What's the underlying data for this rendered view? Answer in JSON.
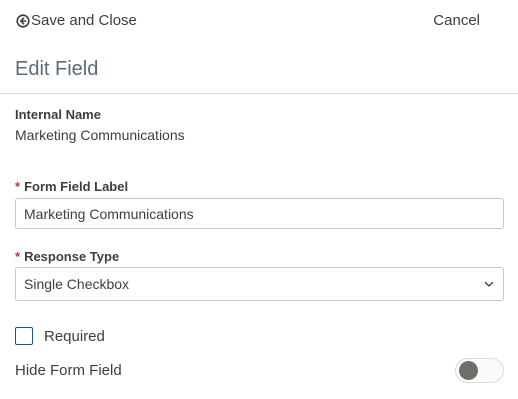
{
  "header": {
    "save_close_label": "Save and Close",
    "save_close_icon": "arrow-circle-back-icon",
    "cancel_label": "Cancel"
  },
  "panel": {
    "title": "Edit Field"
  },
  "fields": {
    "internal_name": {
      "label": "Internal Name",
      "value": "Marketing Communications"
    },
    "form_field_label": {
      "required_marker": "*",
      "label": "Form Field Label",
      "value": "Marketing Communications"
    },
    "response_type": {
      "required_marker": "*",
      "label": "Response Type",
      "selected": "Single Checkbox",
      "icon": "chevron-down-icon"
    },
    "required": {
      "label": "Required",
      "checked": false
    },
    "hide_form_field": {
      "label": "Hide Form Field",
      "enabled": false
    }
  },
  "colors": {
    "required_marker": "#c23934",
    "checkbox_border": "#1b5297",
    "toggle_knob": "#706e6b",
    "divider": "#dddbda"
  }
}
